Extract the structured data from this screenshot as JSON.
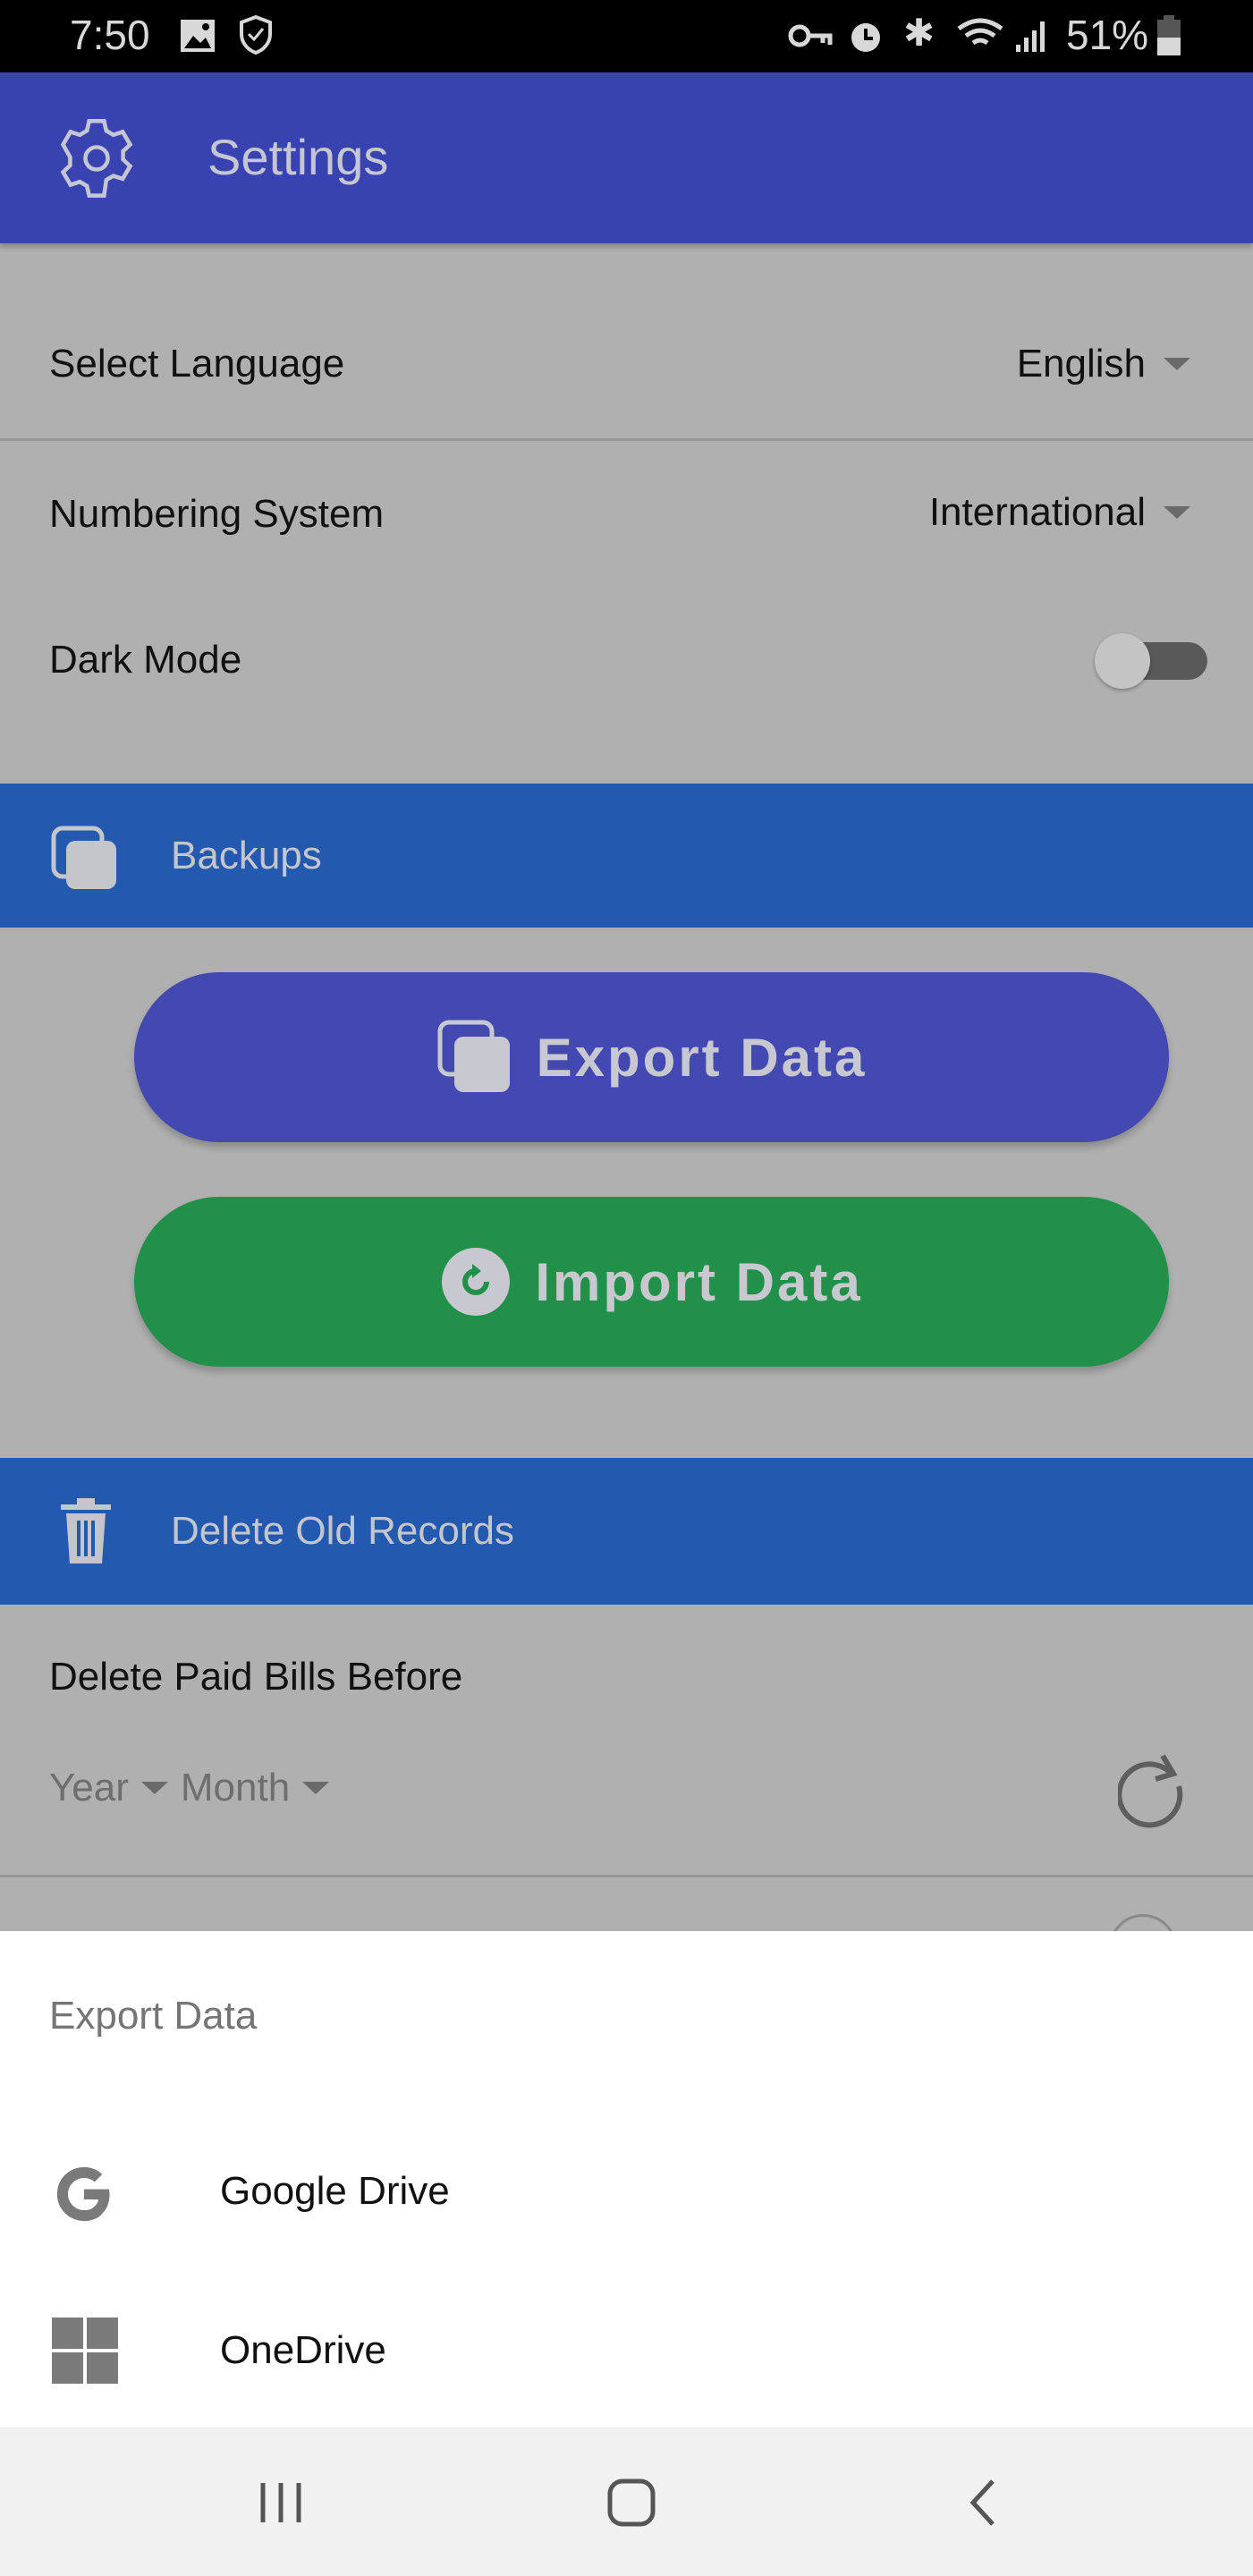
{
  "status_bar": {
    "time": "7:50",
    "battery": "51%",
    "icons": [
      "image-icon",
      "shield-icon",
      "vpn-key-icon",
      "alarm-icon",
      "bluetooth-icon",
      "wifi-icon",
      "signal-icon",
      "battery-icon"
    ]
  },
  "app_bar": {
    "title": "Settings",
    "icon": "gear-icon",
    "color": "#3842b0"
  },
  "settings": {
    "language": {
      "label": "Select Language",
      "value": "English"
    },
    "numbering": {
      "label": "Numbering System",
      "value": "International"
    },
    "dark_mode": {
      "label": "Dark Mode",
      "enabled": false
    }
  },
  "backups": {
    "header": "Backups",
    "export_label": "Export Data",
    "import_label": "Import Data",
    "export_color": "#4349b0",
    "import_color": "#21914a",
    "header_color": "#2459b0"
  },
  "delete_old": {
    "header": "Delete Old Records",
    "label": "Delete Paid Bills Before",
    "year_placeholder": "Year",
    "month_placeholder": "Month"
  },
  "bottom_sheet": {
    "title": "Export Data",
    "options": [
      {
        "label": "Google Drive",
        "icon": "google-icon"
      },
      {
        "label": "OneDrive",
        "icon": "windows-icon"
      }
    ]
  },
  "nav_bar": {
    "buttons": [
      "recents",
      "home",
      "back"
    ]
  }
}
